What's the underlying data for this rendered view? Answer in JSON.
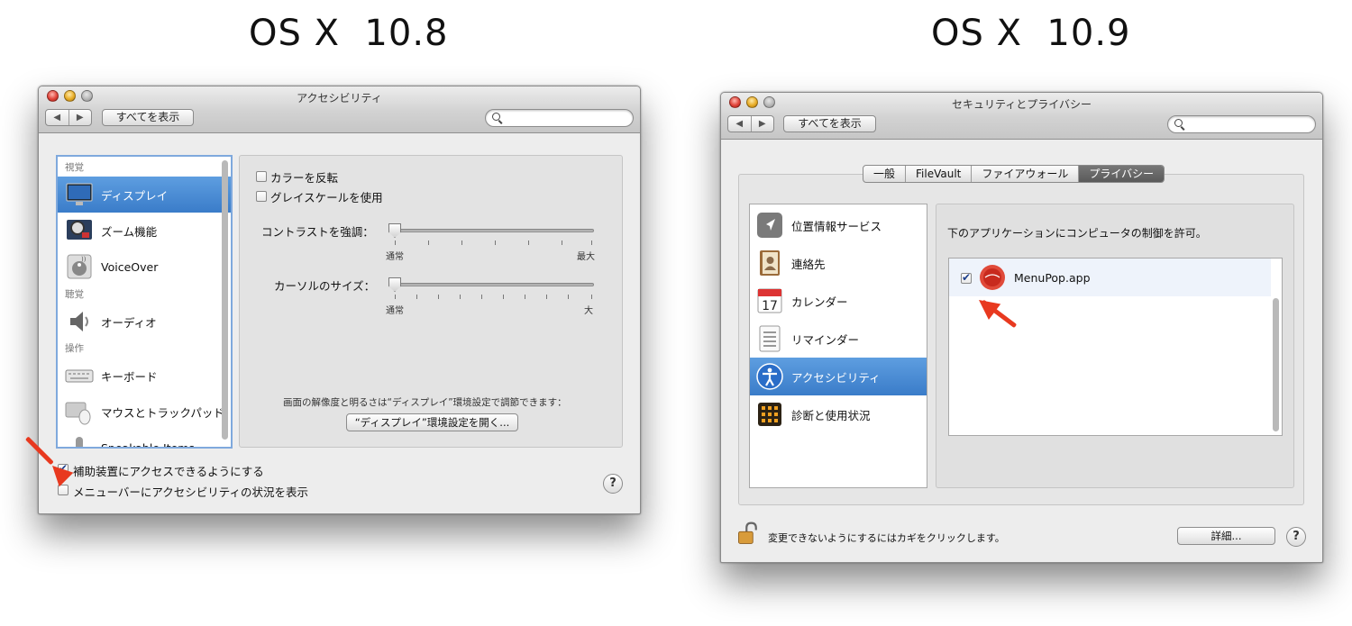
{
  "headings": {
    "left": "OS X  10.8",
    "right": "OS X  10.9"
  },
  "left_window": {
    "title": "アクセシビリティ",
    "nav": {
      "back": "◀",
      "forward": "▶"
    },
    "show_all": "すべてを表示",
    "sections": {
      "vision": "視覚",
      "hearing": "聴覚",
      "interaction": "操作"
    },
    "items": [
      "ディスプレイ",
      "ズーム機能",
      "VoiceOver",
      "オーディオ",
      "キーボード",
      "マウスとトラックパッド",
      "Speakable Items"
    ],
    "selected_item": "ディスプレイ",
    "options": {
      "invert_colors": "カラーを反転",
      "grayscale": "グレイスケールを使用",
      "contrast_label": "コントラストを強調：",
      "contrast_min": "通常",
      "contrast_max": "最大",
      "contrast_value": 0,
      "cursor_label": "カーソルのサイズ：",
      "cursor_min": "通常",
      "cursor_max": "大",
      "cursor_value": 0,
      "note": "画面の解像度と明るさは“ディスプレイ”環境設定で調節できます：",
      "open_display_button": "“ディスプレイ”環境設定を開く..."
    },
    "bottom": {
      "enable_assistive": "補助装置にアクセスできるようにする",
      "enable_assistive_checked": true,
      "show_status_menu": "メニューバーにアクセシビリティの状況を表示",
      "show_status_menu_checked": false,
      "help": "?"
    }
  },
  "right_window": {
    "title": "セキュリティとプライバシー",
    "nav": {
      "back": "◀",
      "forward": "▶"
    },
    "show_all": "すべてを表示",
    "tabs": [
      "一般",
      "FileVault",
      "ファイアウォール",
      "プライバシー"
    ],
    "active_tab": "プライバシー",
    "privacy_items": [
      "位置情報サービス",
      "連絡先",
      "カレンダー",
      "リマインダー",
      "アクセシビリティ",
      "診断と使用状況"
    ],
    "selected_item": "アクセシビリティ",
    "calendar_day": "17",
    "description": "下のアプリケーションにコンピュータの制御を許可。",
    "apps": [
      {
        "name": "MenuPop.app",
        "checked": true
      }
    ],
    "lock_text": "変更できないようにするにはカギをクリックします。",
    "details_button": "詳細...",
    "help": "?"
  },
  "colors": {
    "selection": "#3a7cc9",
    "arrow": "#e8391f",
    "checkmark": "#1d3f8c"
  }
}
